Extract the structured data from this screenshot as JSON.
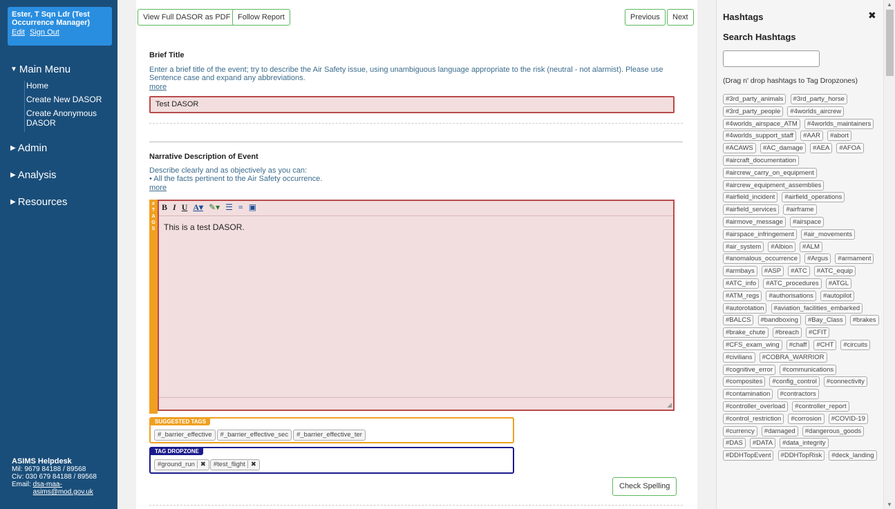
{
  "user": {
    "name": "Ester, T Sqn Ldr (Test Occurrence Manager)",
    "edit": "Edit",
    "signout": "Sign Out"
  },
  "menu": {
    "main": "Main Menu",
    "items": [
      "Home",
      "Create New DASOR",
      "Create Anonymous DASOR"
    ],
    "admin": "Admin",
    "analysis": "Analysis",
    "resources": "Resources"
  },
  "helpdesk": {
    "title": "ASIMS Helpdesk",
    "mil": "Mil: 9679 84188 / 89568",
    "civ": "Civ: 030 679 84188 / 89568",
    "email_label": "Email:",
    "email": "dsa-maa-asims@mod.gov.uk"
  },
  "toolbar": {
    "pdf": "View Full DASOR as PDF",
    "follow": "Follow Report",
    "previous": "Previous",
    "next": "Next"
  },
  "brief_title": {
    "heading": "Brief Title",
    "instructions": "Enter a brief title of the event; try to describe the Air Safety issue, using unambiguous language appropriate to the risk (neutral - not alarmist). Please use Sentence case and expand any abbreviations.",
    "more": "more",
    "value": "Test DASOR"
  },
  "narrative": {
    "heading": "Narrative Description of Event",
    "instructions_1": "Describe clearly and as objectively as you can:",
    "instructions_2": "• All the facts pertinent to the Air Safety occurrence.",
    "more": "more",
    "tag_strip": "# T A G S",
    "editor_buttons": [
      "B",
      "I",
      "U",
      "A",
      "ab",
      "bullets",
      "numbers",
      "paste"
    ],
    "body": "This is a test DASOR."
  },
  "suggested_tags": {
    "label": "SUGGESTED TAGS",
    "color": "#f0a020",
    "tags": [
      "#_barrier_effective",
      "#_barrier_effective_sec",
      "#_barrier_effective_ter"
    ]
  },
  "dropzone": {
    "label": "TAG DROPZONE",
    "color": "#1a1a8c",
    "tags": [
      "#ground_run",
      "#test_flight"
    ],
    "remove_icon": "✖"
  },
  "spell": "Check Spelling",
  "hashtags": {
    "title": "Hashtags",
    "close_icon": "✖",
    "search_title": "Search Hashtags",
    "hint": "(Drag n' drop hashtags to Tag Dropzones)",
    "list": [
      "#3rd_party_animals",
      "#3rd_party_horse",
      "#3rd_party_people",
      "#4worlds_aircrew",
      "#4worlds_airspace_ATM",
      "#4worlds_maintainers",
      "#4worlds_support_staff",
      "#AAR",
      "#abort",
      "#ACAWS",
      "#AC_damage",
      "#AEA",
      "#AFOA",
      "#aircraft_documentation",
      "#aircrew_carry_on_equipment",
      "#aircrew_equipment_assemblies",
      "#airfield_incident",
      "#airfield_operations",
      "#airfield_services",
      "#airframe",
      "#airmove_message",
      "#airspace",
      "#airspace_infringement",
      "#air_movements",
      "#air_system",
      "#Albion",
      "#ALM",
      "#anomalous_occurrence",
      "#Argus",
      "#armament",
      "#armbays",
      "#ASP",
      "#ATC",
      "#ATC_equip",
      "#ATC_info",
      "#ATC_procedures",
      "#ATGL",
      "#ATM_regs",
      "#authorisations",
      "#autopilot",
      "#autorotation",
      "#aviation_facilities_embarked",
      "#BALCS",
      "#bandboxing",
      "#Bay_Class",
      "#brakes",
      "#brake_chute",
      "#breach",
      "#CFIT",
      "#CFS_exam_wing",
      "#chaff",
      "#CHT",
      "#circuits",
      "#civilians",
      "#COBRA_WARRIOR",
      "#cognitive_error",
      "#communications",
      "#composites",
      "#config_control",
      "#connectivity",
      "#contamination",
      "#contractors",
      "#controller_overload",
      "#controller_report",
      "#control_restriction",
      "#corrosion",
      "#COVID-19",
      "#currency",
      "#damaged",
      "#dangerous_goods",
      "#DAS",
      "#DATA",
      "#data_integrity",
      "#DDHTopEvent",
      "#DDHTopRisk",
      "#deck_landing"
    ]
  }
}
